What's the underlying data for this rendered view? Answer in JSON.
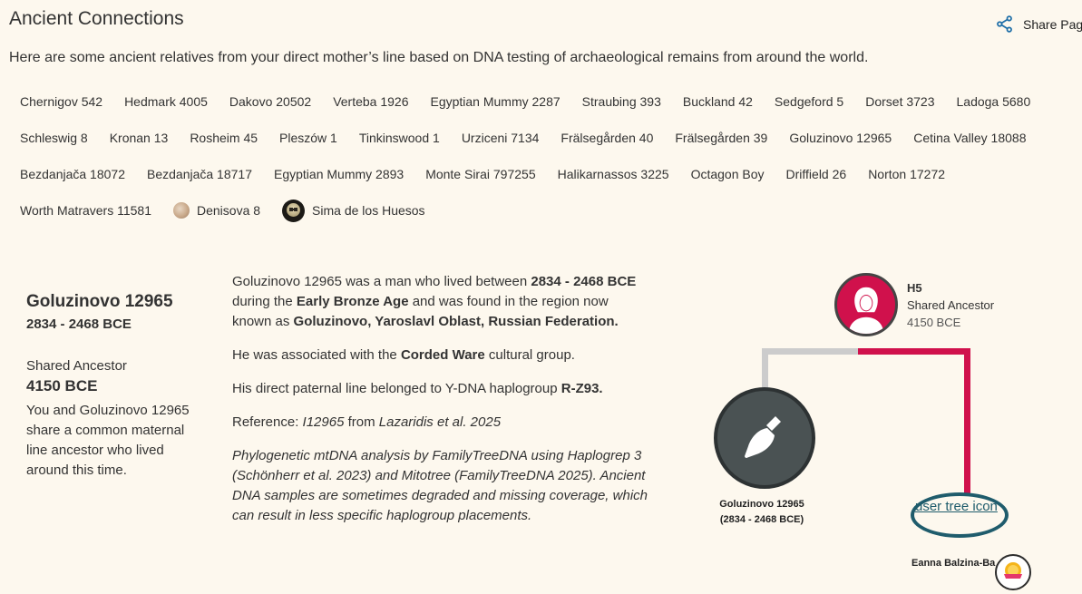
{
  "header": {
    "title": "Ancient Connections",
    "share_label": "Share Pag",
    "intro": "Here are some ancient relatives from your direct mother’s line based on DNA testing of archaeological remains from around the world."
  },
  "tags": [
    [
      "Chernigov 542",
      "Hedmark 4005",
      "Dakovo 20502",
      "Verteba 1926",
      "Egyptian Mummy 2287",
      "Straubing 393",
      "Buckland 42",
      "Sedgeford 5",
      "Dorset 3723",
      "Ladoga 5680"
    ],
    [
      "Schleswig 8",
      "Kronan 13",
      "Rosheim 45",
      "Pleszów 1",
      "Tinkinswood 1",
      "Urziceni 7134",
      "Frälsegården 40",
      "Frälsegården 39",
      "Goluzinovo 12965",
      "Cetina Valley 18088"
    ],
    [
      "Bezdanjača 18072",
      "Bezdanjača 18717",
      "Egyptian Mummy 2893",
      "Monte Sirai 797255",
      "Halikarnassos 3225",
      "Octagon Boy",
      "Driffield 26",
      "Norton 17272"
    ],
    [
      "Worth Matravers 11581",
      "Denisova 8",
      "Sima de los Huesos"
    ]
  ],
  "detail": {
    "name": "Goluzinovo 12965",
    "dates": "2834 - 2468 BCE",
    "shared_ancestor_label": "Shared Ancestor",
    "shared_ancestor_year": "4150 BCE",
    "summary": "You and Goluzinovo 12965 share a common maternal line ancestor who lived around this time.",
    "p1_a": "Goluzinovo 12965 was a man who lived between ",
    "p1_b": "2834 - 2468 BCE",
    "p1_c": " during the ",
    "p1_d": "Early Bronze Age",
    "p1_e": " and was found in the region now known as ",
    "p1_f": "Goluzinovo, Yaroslavl Oblast, Russian Federation.",
    "p2_a": "He was associated with the ",
    "p2_b": "Corded Ware",
    "p2_c": " cultural group.",
    "p3_a": "His direct paternal line belonged to Y-DNA haplogroup ",
    "p3_b": "R-Z93.",
    "p4_a": "Reference: ",
    "p4_b": "I12965",
    "p4_c": " from ",
    "p4_d": "Lazaridis et al. 2025",
    "note": "Phylogenetic mtDNA analysis by FamilyTreeDNA using Haplogrep 3 (Schönherr et al. 2023) and Mitotree (FamilyTreeDNA 2025). Ancient DNA samples are sometimes degraded and missing coverage, which can result in less specific haplogroup placements."
  },
  "tree": {
    "haplogroup": "H5",
    "shared_label": "Shared Ancestor",
    "shared_year": "4150 BCE",
    "ancient_name": "Goluzinovo 12965",
    "ancient_dates": "(2834 - 2468 BCE)",
    "user_img_alt": "user tree icon",
    "user_name": "Eanna Balzina-Ba",
    "colors": {
      "maternal": "#d0114c",
      "grey_line": "#cccccc",
      "user_ring": "#1f5c6c"
    }
  }
}
